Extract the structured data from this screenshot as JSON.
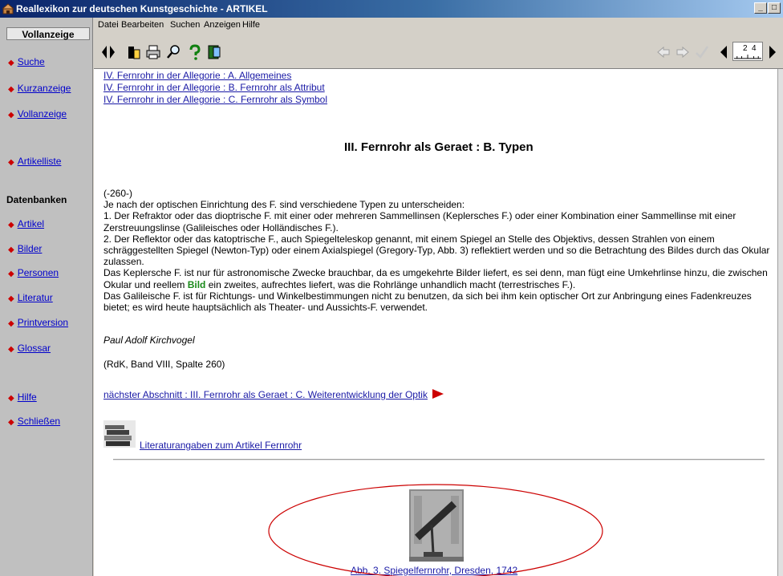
{
  "window": {
    "title": "Reallexikon zur deutschen Kunstgeschichte - ARTIKEL",
    "controls": [
      "_",
      "□"
    ]
  },
  "sidebar": {
    "header": "Vollanzeige",
    "nav": [
      "Suche",
      "Kurzanzeige",
      "Vollanzeige",
      "Artikelliste"
    ],
    "db_heading": "Datenbanken",
    "db": [
      "Artikel",
      "Bilder",
      "Personen",
      "Literatur",
      "Printversion",
      "Glossar"
    ],
    "footer": [
      "Hilfe",
      "Schließen"
    ]
  },
  "menu": [
    "Datei",
    "Bearbeiten",
    "Suchen",
    "Anzeigen",
    "Hilfe"
  ],
  "toolbar": {
    "page_current": "2",
    "page_total": "4",
    "icons": [
      "panel-toggle-icon",
      "book-icon",
      "print-icon",
      "search-icon",
      "help-icon",
      "exit-icon",
      "back-arrow-icon",
      "forward-arrow-icon",
      "check-icon",
      "prev-page-icon",
      "next-page-icon"
    ]
  },
  "content": {
    "toc_links": [
      "IV. Fernrohr in der Allegorie : A. Allgemeines",
      "IV. Fernrohr in der Allegorie : B. Fernrohr als Attribut",
      "IV. Fernrohr in der Allegorie : C. Fernrohr als Symbol"
    ],
    "section_title": "III. Fernrohr als Geraet : B. Typen",
    "column_marker": "(-260-)",
    "paragraphs": [
      "Je nach der optischen Einrichtung des F. sind verschiedene Typen zu unterscheiden:",
      "1. Der Refraktor oder das dioptrische F. mit einer oder mehreren Sammellinsen (Keplersches F.) oder einer Kombination einer Sammellinse mit einer Zerstreuungslinse (Galileisches oder Holländisches F.).",
      "2. Der Reflektor oder das katoptrische F., auch Spiegelteleskop genannt, mit einem Spiegel an Stelle des Objektivs, dessen Strahlen von einem schräggestellten Spiegel (Newton-Typ) oder einem Axialspiegel (Gregory-Typ, Abb. 3) reflektiert werden und so die Betrachtung des Bildes durch das Okular zulassen."
    ],
    "kepler_pre": "Das Keplersche F. ist nur für astronomische Zwecke brauchbar, da es umgekehrte Bilder liefert, es sei denn, man fügt eine Umkehrlinse hinzu, die zwischen Okular und reellem ",
    "kepler_bild": "Bild",
    "kepler_post": " ein zweites, aufrechtes liefert, was die Rohrlänge unhandlich macht (terrestrisches F.).",
    "galilei": "Das Galileische F. ist für Richtungs- und Winkelbestimmungen nicht zu benutzen, da sich bei ihm kein optischer Ort zur Anbringung eines Fadenkreuzes bietet; es wird heute hauptsächlich als Theater- und Aussichts-F. verwendet.",
    "author": "Paul Adolf Kirchvogel",
    "citation": "(RdK, Band VIII, Spalte 260)",
    "next_link": "nächster Abschnitt : III. Fernrohr als Geraet : C. Weiterentwicklung der Optik",
    "literature_link": "Literaturangaben zum Artikel Fernrohr",
    "figure_caption": "Abb. 3. Spiegelfernrohr, Dresden, 1742"
  },
  "colors": {
    "title_gradient_start": "#0a246a",
    "title_gradient_end": "#a6caf0",
    "sidebar_bg": "#c0c0c0",
    "link": "#1a1aa6",
    "bild_green": "#1a8a1a",
    "bullet_red": "#cc0000",
    "annotation_ellipse": "#cc0000"
  }
}
